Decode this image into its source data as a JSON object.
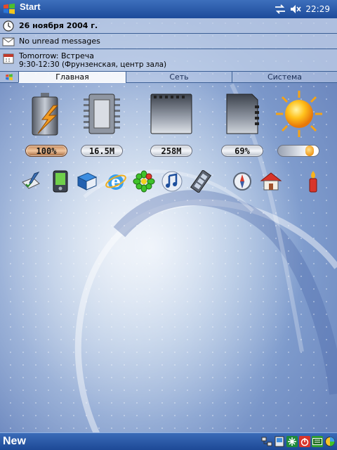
{
  "titlebar": {
    "title": "Start",
    "clock": "22:29",
    "connectivity_icon": "sync-arrows-icon",
    "volume_icon": "speaker-muted-icon"
  },
  "today": {
    "date": "26 ноября 2004 г.",
    "messages": "No unread messages",
    "appointment_title": "Tomorrow: Встреча",
    "appointment_detail": "9:30-12:30 (Фрунзенская, центр зала)"
  },
  "tabs": [
    {
      "label": "Главная",
      "active": true
    },
    {
      "label": "Сеть",
      "active": false
    },
    {
      "label": "Система",
      "active": false
    }
  ],
  "widgets": {
    "battery": {
      "value": "100%",
      "icon": "battery-charging-icon"
    },
    "memory": {
      "value": "16.5M",
      "icon": "memory-chip-icon"
    },
    "storage": {
      "value": "258M",
      "icon": "storage-card-icon"
    },
    "sd_card": {
      "value": "69%",
      "icon": "sd-card-icon"
    },
    "brightness": {
      "icon": "sun-icon",
      "level": 0.85
    }
  },
  "apps": [
    "tasks-pen-icon",
    "pda-device-icon",
    "book-icon",
    "internet-explorer-icon",
    "icq-flower-icon",
    "media-player-icon",
    "film-strip-icon",
    "compass-icon",
    "home-icon",
    "candle-icon"
  ],
  "menubar": {
    "left_label": "New",
    "tray_icons": [
      "network-icon",
      "pda-sync-icon",
      "snowflake-icon",
      "power-icon",
      "keyboard-icon",
      "color-wheel-icon"
    ]
  },
  "colors": {
    "titlebar": "#1d4b9a",
    "accent": "#3b5f95"
  }
}
